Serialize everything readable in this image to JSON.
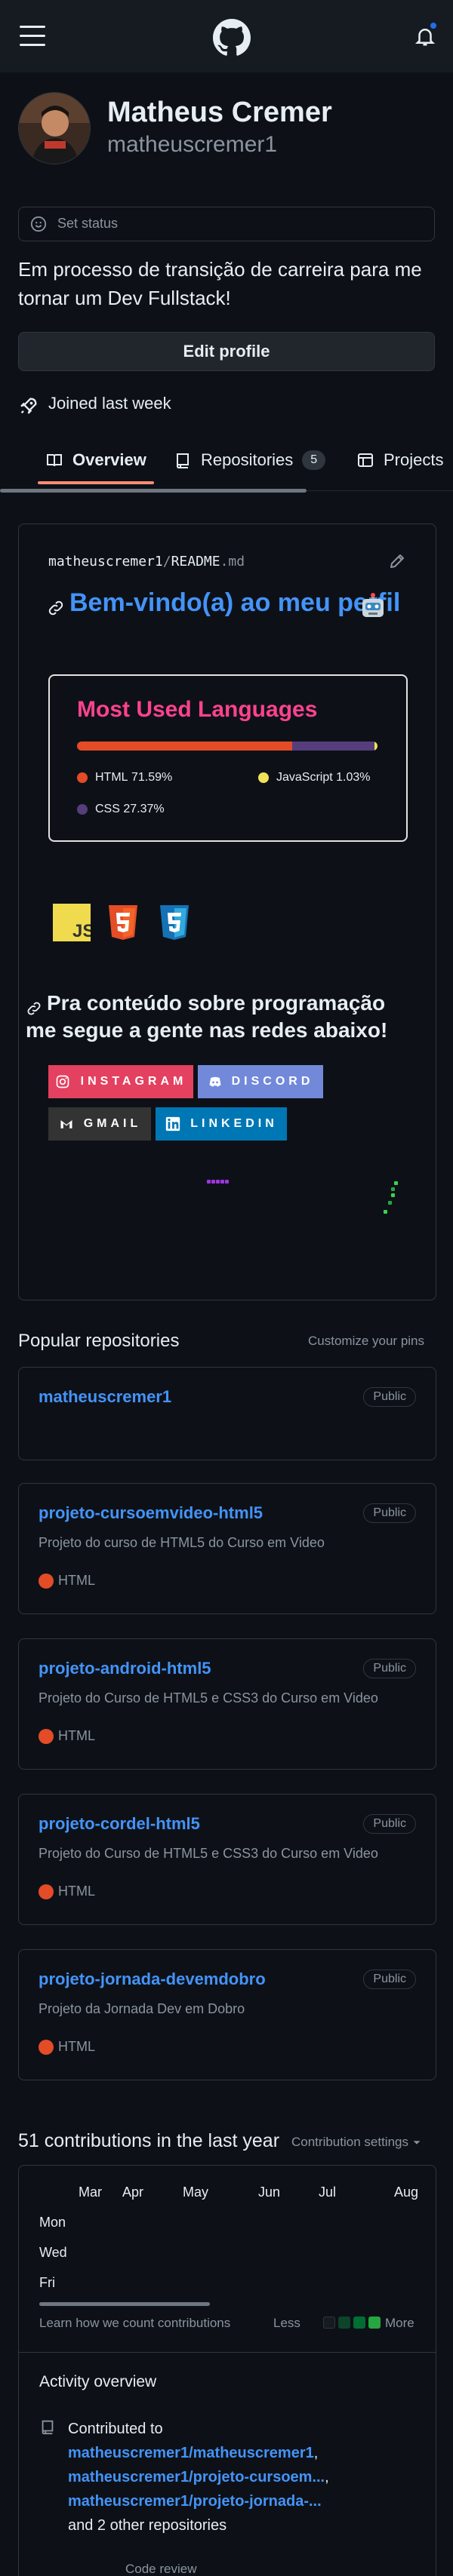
{
  "header": {
    "menu_icon": "hamburger-icon",
    "logo_icon": "github-logo-icon",
    "notifications_icon": "bell-icon"
  },
  "profile": {
    "full_name": "Matheus Cremer",
    "username": "matheuscremer1",
    "status_placeholder": "Set status",
    "bio": "Em processo de transição de carreira para me tornar um Dev Fullstack!",
    "edit_button": "Edit profile",
    "joined": "Joined last week"
  },
  "tabs": [
    {
      "label": "Overview",
      "icon": "book-icon",
      "active": true
    },
    {
      "label": "Repositories",
      "icon": "repo-icon",
      "count": "5"
    },
    {
      "label": "Projects",
      "icon": "table-icon"
    }
  ],
  "readme": {
    "owner": "matheuscremer1",
    "separator": "/",
    "file": "README",
    "ext": ".md",
    "heading": "Bem-vindo(a) ao meu perfil",
    "langs_card": {
      "title": "Most Used Languages",
      "languages": [
        {
          "name": "HTML",
          "percent": "71.59%",
          "value": 71.59,
          "color": "#e34c26"
        },
        {
          "name": "CSS",
          "percent": "27.37%",
          "value": 27.37,
          "color": "#563d7c"
        },
        {
          "name": "JavaScript",
          "percent": "1.03%",
          "value": 1.03,
          "color": "#f1e05a"
        }
      ]
    },
    "tech_icons": [
      "javascript-icon",
      "html5-icon",
      "css3-icon"
    ],
    "subheading": "Pra conteúdo sobre programação me segue a gente nas redes abaixo!",
    "badges": [
      {
        "label": "INSTAGRAM",
        "icon": "instagram-icon",
        "color": "#e4405f"
      },
      {
        "label": "DISCORD",
        "icon": "discord-icon",
        "color": "#7289da"
      },
      {
        "label": "GMAIL",
        "icon": "gmail-icon",
        "color": "#333333"
      },
      {
        "label": "LINKEDIN",
        "icon": "linkedin-icon",
        "color": "#0077b5"
      }
    ]
  },
  "popular": {
    "title": "Popular repositories",
    "customize": "Customize your pins",
    "repos": [
      {
        "name": "matheuscremer1",
        "visibility": "Public",
        "description": "",
        "language": ""
      },
      {
        "name": "projeto-cursoemvideo-html5",
        "visibility": "Public",
        "description": "Projeto do curso de HTML5 do Curso em Video",
        "language": "HTML"
      },
      {
        "name": "projeto-android-html5",
        "visibility": "Public",
        "description": "Projeto do Curso de HTML5 e CSS3 do Curso em Video",
        "language": "HTML"
      },
      {
        "name": "projeto-cordel-html5",
        "visibility": "Public",
        "description": "Projeto do Curso de HTML5 e CSS3 do Curso em Video",
        "language": "HTML"
      },
      {
        "name": "projeto-jornada-devemdobro",
        "visibility": "Public",
        "description": "Projeto da Jornada Dev em Dobro",
        "language": "HTML"
      }
    ]
  },
  "contributions": {
    "title": "51 contributions in the last year",
    "settings": "Contribution settings",
    "months": [
      "Mar",
      "Apr",
      "May",
      "Jun",
      "Jul",
      "Aug"
    ],
    "days": [
      "Mon",
      "Wed",
      "Fri"
    ],
    "learn_link": "Learn how we count contributions",
    "less": "Less",
    "more": "More",
    "legend_colors": [
      "#161b22",
      "#0e4429",
      "#006d32",
      "#26a641",
      "#39d353"
    ]
  },
  "activity": {
    "title": "Activity overview",
    "contributed_to": "Contributed to",
    "repos": [
      "matheuscremer1/matheuscremer1",
      "matheuscremer1/projeto-cursoem...",
      "matheuscremer1/projeto-jornada-..."
    ],
    "others": "and 2 other repositories",
    "code_review": "Code review"
  }
}
